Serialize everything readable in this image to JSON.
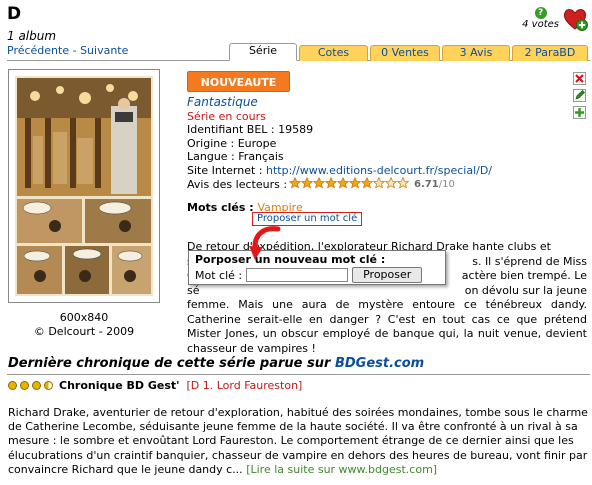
{
  "header": {
    "title": "D",
    "album_count": "1 album",
    "prev": "Précédente",
    "separator": " - ",
    "next": "Suivante",
    "help_icon": "?",
    "votes": "4 votes"
  },
  "tabs": [
    {
      "label": "Série",
      "active": true
    },
    {
      "label": "Cotes",
      "active": false
    },
    {
      "label": "0 Ventes",
      "active": false
    },
    {
      "label": "3 Avis",
      "active": false
    },
    {
      "label": "2 ParaBD",
      "active": false
    }
  ],
  "cover": {
    "size": "600x840",
    "copyright": "© Delcourt - 2009"
  },
  "info": {
    "badge": "NOUVEAUTE",
    "genre": "Fantastique",
    "status": "Série en cours",
    "id_label": "Identifiant BEL : ",
    "id_value": "19589",
    "origin_label": "Origine : ",
    "origin_value": "Europe",
    "lang_label": "Langue : ",
    "lang_value": "Français",
    "site_label": "Site Internet : ",
    "site_value": "http://www.editions-delcourt.fr/special/D/",
    "rating_label": "Avis des lecteurs : ",
    "rating_value": "6.71",
    "rating_max": "/10",
    "rating_stars": 6.71,
    "keywords_label": "Mots clés : ",
    "keyword": "Vampire",
    "propose_keyword": "Proposer un mot clé"
  },
  "popup": {
    "title": "Porposer un nouveau mot clé :",
    "field_label": "Mot clé :",
    "field_value": "",
    "button": "Proposer"
  },
  "description": {
    "line1": "De retour d'expédition, l'explorateur Richard Drake hante clubs et",
    "line2": "so",
    "line2_end": "s. Il s'éprend de Miss",
    "line3": "C",
    "line3_end": "actère bien trempé. Le",
    "line4": "sé",
    "line4_end": "on dévolu sur la jeune",
    "rest": "femme. Mais une aura de mystère entoure ce ténébreux dandy. Catherine serait-elle en danger ? C'est en tout cas ce que prétend Mister Jones, un obscur employé de banque qui, la nuit venue, devient chasseur de vampires !"
  },
  "chronicle": {
    "title_prefix": "Dernière chronique de cette série parue sur ",
    "site": "BDGest.com",
    "name": "Chronique BD Gest'",
    "album": "[D 1. Lord Faureston]",
    "text": "Richard Drake, aventurier de retour d'exploration, habitué des soirées mondaines, tombe sous le charme de Catherine Lecombe, séduisante jeune femme de la haute société. Il va être confronté à un rival à sa mesure : le sombre et envoûtant Lord Faureston. Le comportement étrange de ce dernier ainsi que les élucubrations d'un craintif banquier, chasseur de vampire en dehors des heures de bureau, vont finir par convaincre Richard que le jeune dandy c...",
    "more": "[Lire la suite sur www.bdgest.com]"
  },
  "colors": {
    "link": "#0a4f9c",
    "tab": "#ffd25a",
    "badge": "#f47a20",
    "status": "#c01818",
    "more": "#3d8a2a"
  },
  "icons": [
    "help-icon",
    "heart-add-icon",
    "delete-icon",
    "edit-icon",
    "add-icon",
    "star-icon",
    "red-arrow-icon"
  ]
}
